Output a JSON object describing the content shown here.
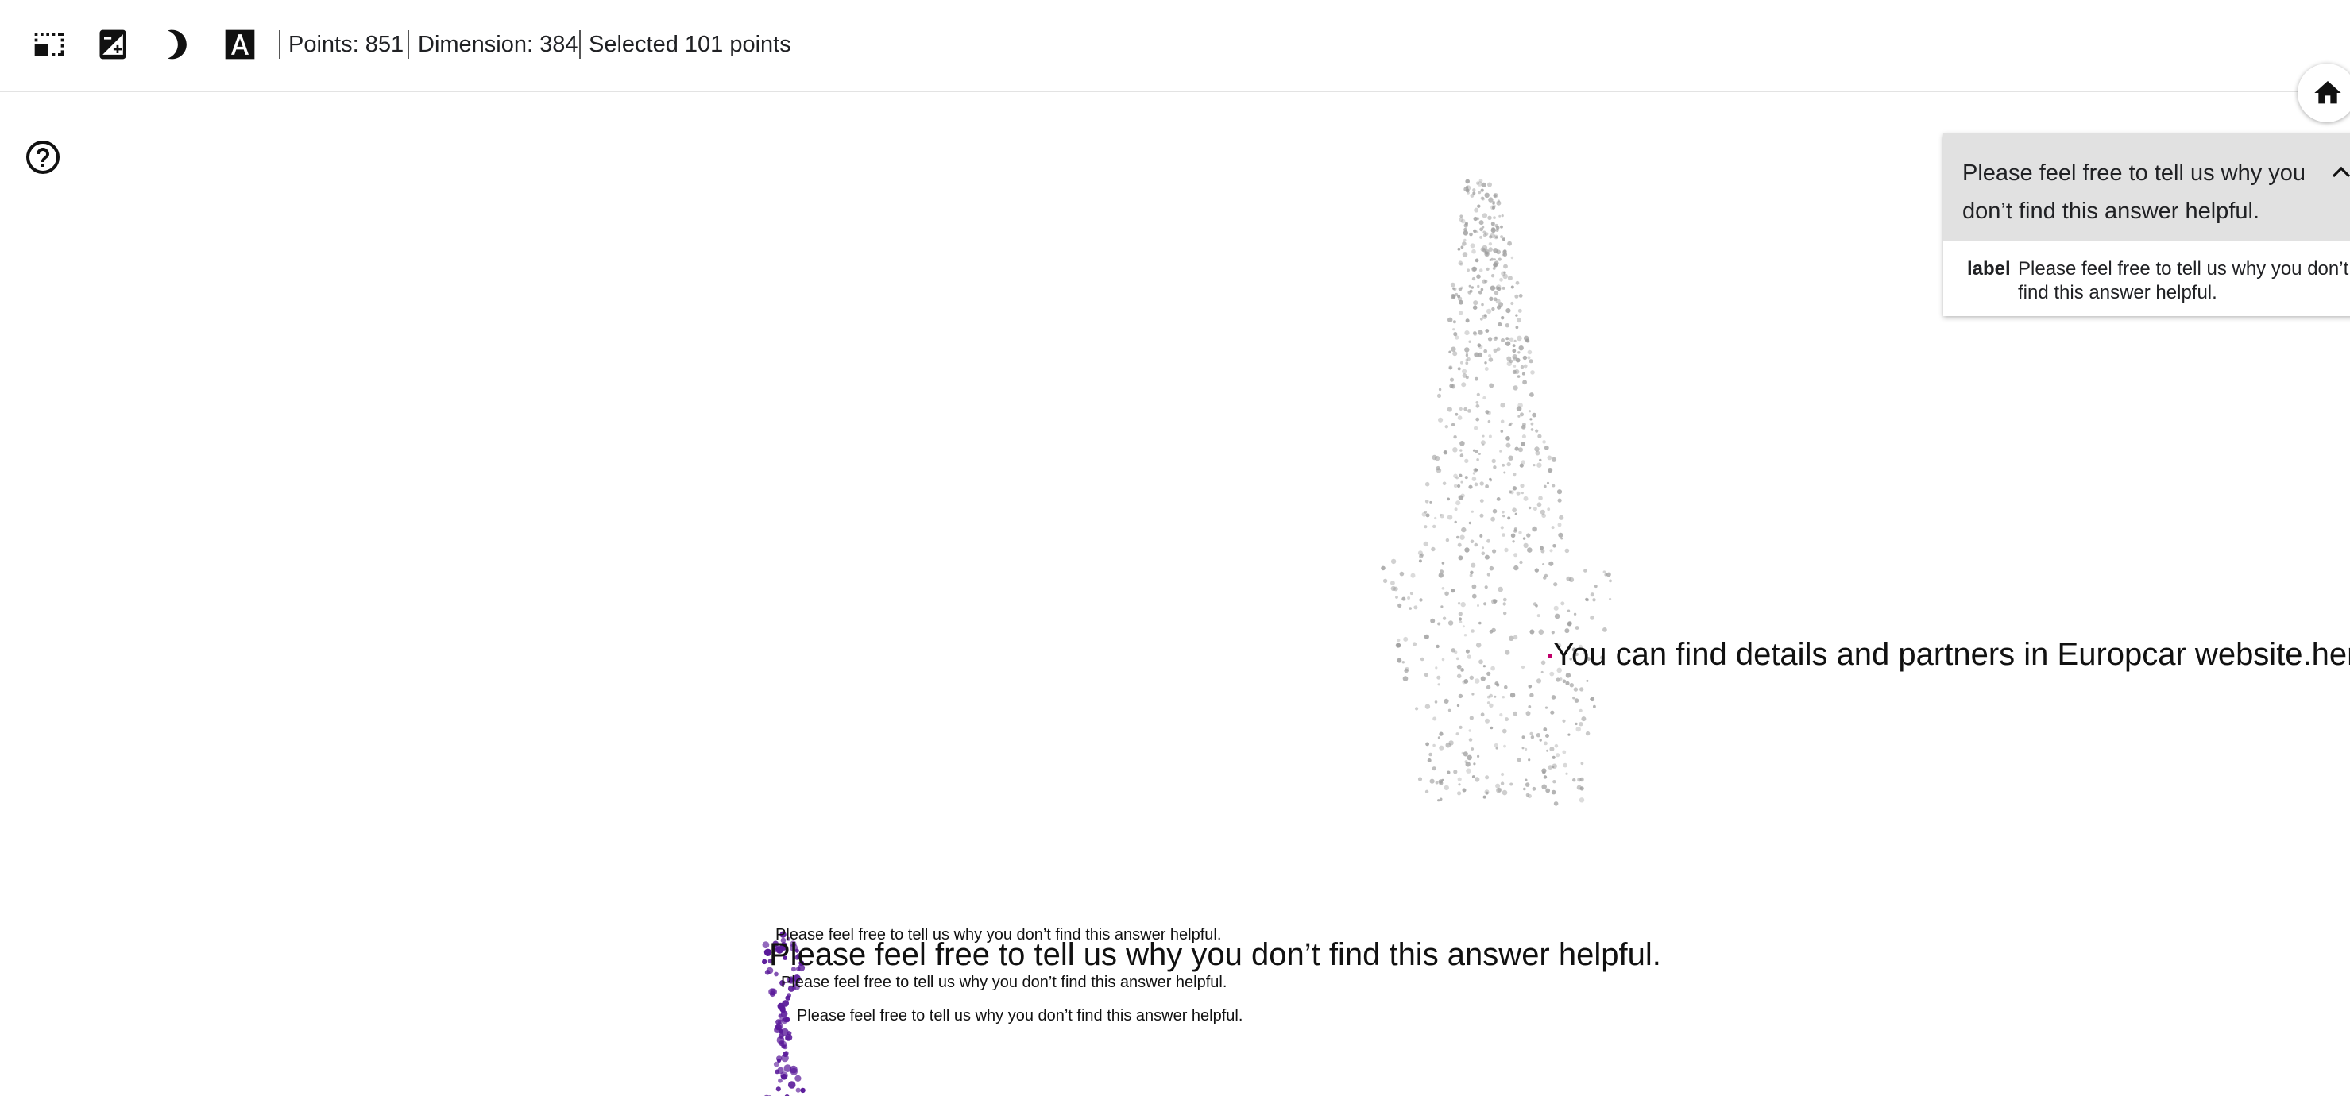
{
  "toolbar": {
    "icons": {
      "select": "rectangle-select-icon",
      "exposure": "exposure-icon",
      "night_mode": "moon-icon",
      "labels": "text-label-icon"
    },
    "points": "Points: 851",
    "dimension": "Dimension: 384",
    "selected": "Selected 101 points"
  },
  "help_icon": "help-circle-icon",
  "home_icon": "home-icon",
  "panel": {
    "title": "Please feel free to tell us why you don’t find this answer helpful.",
    "row_key": "label",
    "row_value": "Please feel free to tell us why you don’t find this answer helpful.",
    "chevron": "chevron-up-icon"
  },
  "labels": {
    "hover_right": "You can find details and partners in Europcar website.here",
    "selected_1": "Please feel free to tell us why you don’t find this answer helpful.",
    "selected_main": "Please feel free to tell us why you don’t find this answer helpful.",
    "selected_2": "Please feel free to tell us why you don’t find this answer helpful.",
    "selected_3": "Please feel free to tell us why you don’t find this answer helpful."
  },
  "colors": {
    "unselected_point": "#9e9e9e",
    "selected_point": "#5a1a9a",
    "panel_header": "#e1e1e1"
  }
}
